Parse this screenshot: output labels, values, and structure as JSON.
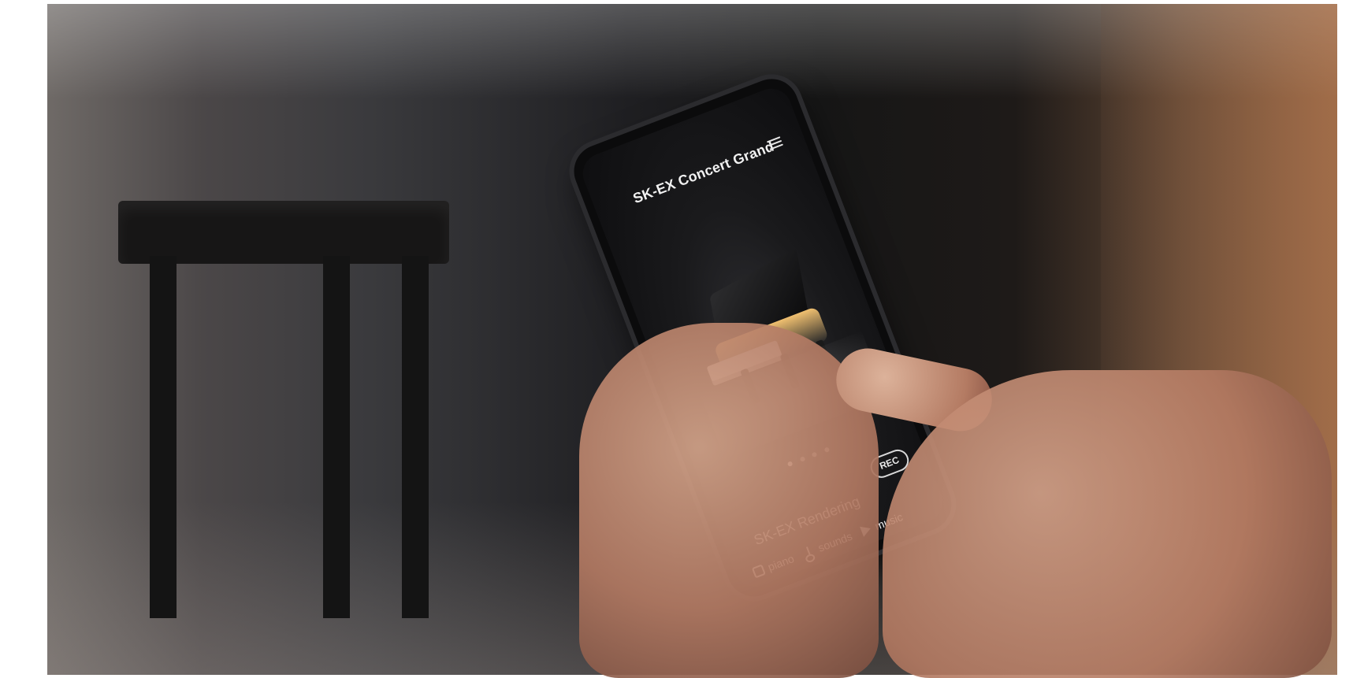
{
  "app": {
    "title": "SK-EX Concert Grand",
    "menu_icon": "menu-icon",
    "carousel": {
      "dots": 4,
      "active_index": 0
    },
    "feature": "SK-EX Rendering",
    "rec_label": "REC",
    "bottom_nav": [
      {
        "label": "piano",
        "icon": "piano-icon"
      },
      {
        "label": "sounds",
        "icon": "sounds-icon"
      },
      {
        "label": "music",
        "icon": "music-icon"
      }
    ]
  }
}
